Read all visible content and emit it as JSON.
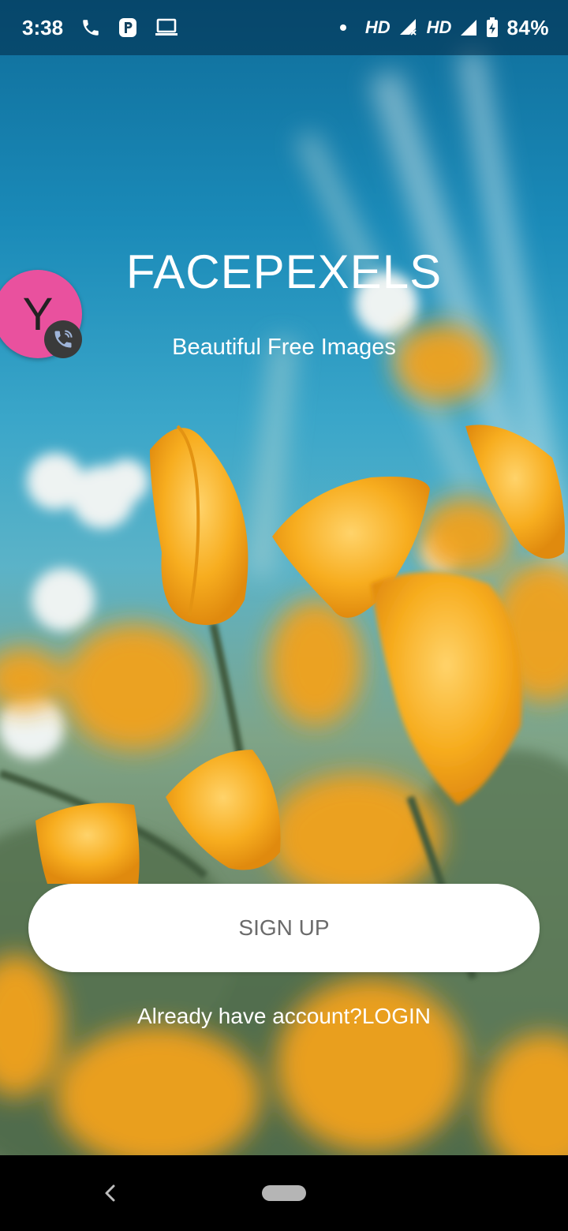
{
  "status_bar": {
    "time": "3:38",
    "left_icons": [
      "phone-icon",
      "parking-icon",
      "laptop-icon"
    ],
    "hd1": "HD",
    "hd2": "HD",
    "battery": "84%"
  },
  "app": {
    "title": "FACEPEXELS",
    "subtitle": "Beautiful Free Images"
  },
  "chat_bubble": {
    "initial": "Y",
    "color": "#e9519e",
    "badge_icon": "phone-call-icon"
  },
  "signup": {
    "label": "SIGN UP"
  },
  "login_link": {
    "text": "Already have account?LOGIN"
  },
  "nav": {
    "back_icon": "back-chevron-icon",
    "home_icon": "home-pill-icon"
  },
  "colors": {
    "sky": "#1a8ab8",
    "flower": "#f5a623",
    "button_bg": "#ffffff",
    "button_text": "#6b6b6b"
  }
}
